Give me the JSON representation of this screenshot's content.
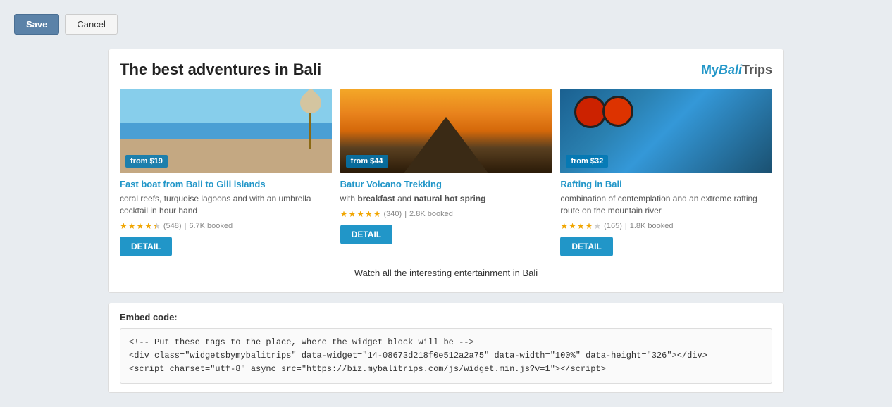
{
  "toolbar": {
    "save_label": "Save",
    "cancel_label": "Cancel"
  },
  "widget": {
    "title": "The best adventures in Bali",
    "brand": {
      "my": "My",
      "bali": "Bali",
      "trips": "Trips"
    },
    "cards": [
      {
        "id": "card-1",
        "scene_class": "beach-scene",
        "price_badge": "from $19",
        "title": "Fast boat from Bali to Gili islands",
        "description": "coral reefs, turquoise lagoons and with an umbrella cocktail in hour hand",
        "stars": 4,
        "half_star": true,
        "rating_count": "(548)",
        "booked": "6.7K booked",
        "detail_label": "DETAIL"
      },
      {
        "id": "card-2",
        "scene_class": "volcano-scene",
        "price_badge": "from $44",
        "title": "Batur Volcano Trekking",
        "description": "with breakfast and natural hot spring",
        "desc_highlight_1": "breakfast",
        "desc_highlight_2": "natural hot spring",
        "stars": 5,
        "half_star": false,
        "rating_count": "(340)",
        "booked": "2.8K booked",
        "detail_label": "DETAIL"
      },
      {
        "id": "card-3",
        "scene_class": "rafting-scene",
        "price_badge": "from $32",
        "title": "Rafting in Bali",
        "description": "combination of contemplation and an extreme rafting route on the mountain river",
        "stars": 4,
        "half_star": false,
        "rating_count": "(165)",
        "booked": "1.8K booked",
        "detail_label": "DETAIL"
      }
    ],
    "watch_link": "Watch all the interesting entertainment in Bali"
  },
  "embed_section": {
    "label": "Embed code:",
    "line1": "<!-- Put these tags to the place, where the widget block will be -->",
    "line2": "<div class=\"widgetsbymybalitrips\" data-widget=\"14-08673d218f0e512a2a75\" data-width=\"100%\" data-height=\"326\"></div>",
    "line3": "<script charset=\"utf-8\" async src=\"https://biz.mybalitrips.com/js/widget.min.js?v=1\"></script>"
  }
}
